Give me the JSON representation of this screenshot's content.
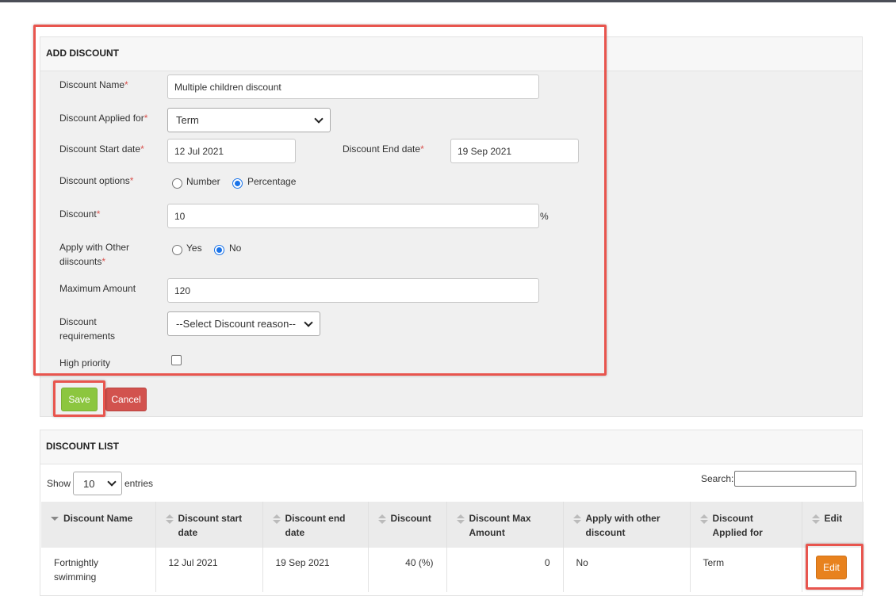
{
  "add_discount": {
    "title": "ADD DISCOUNT",
    "fields": {
      "name": {
        "label": "Discount Name",
        "required": "*",
        "value": "Multiple children discount"
      },
      "applied_for": {
        "label": "Discount Applied for",
        "required": "*",
        "value": "Term"
      },
      "start_date": {
        "label": "Discount Start date",
        "required": "*",
        "value": "12 Jul 2021"
      },
      "end_date": {
        "label": "Discount End date",
        "required": "*",
        "value": "19 Sep 2021"
      },
      "options": {
        "label": "Discount options",
        "required": "*",
        "choice_number": "Number",
        "choice_percentage": "Percentage",
        "selected": "Percentage"
      },
      "discount": {
        "label": "Discount",
        "required": "*",
        "value": "10",
        "suffix": "%"
      },
      "apply_other": {
        "label_line1": "Apply with Other",
        "label_line2": "diiscounts",
        "required": "*",
        "choice_yes": "Yes",
        "choice_no": "No",
        "selected": "No"
      },
      "max_amount": {
        "label": "Maximum Amount",
        "value": "120"
      },
      "requirements": {
        "label_line1": "Discount",
        "label_line2": "requirements",
        "value": "--Select Discount reason--"
      },
      "high_priority": {
        "label": "High priority",
        "checked": false
      }
    },
    "save_label": "Save",
    "cancel_label": "Cancel"
  },
  "discount_list": {
    "title": "DISCOUNT LIST",
    "show_label": "Show",
    "page_length": "10",
    "entries_label": "entries",
    "search_label": "Search:",
    "columns": [
      {
        "line1": "Discount Name",
        "line2": ""
      },
      {
        "line1": "Discount start",
        "line2": "date"
      },
      {
        "line1": "Discount end",
        "line2": "date"
      },
      {
        "line1": "Discount",
        "line2": ""
      },
      {
        "line1": "Discount Max",
        "line2": "Amount"
      },
      {
        "line1": "Apply with other",
        "line2": "discount"
      },
      {
        "line1": "Discount",
        "line2": "Applied for"
      },
      {
        "line1": "Edit",
        "line2": ""
      }
    ],
    "rows": [
      {
        "name_line1": "Fortnightly",
        "name_line2": "swimming",
        "start": "12 Jul 2021",
        "end": "19 Sep 2021",
        "discount": "40 (%)",
        "max_amount": "0",
        "apply_other": "No",
        "applied_for": "Term",
        "edit_label": "Edit"
      }
    ]
  },
  "colors": {
    "highlight": "#e8554e",
    "save": "#8cc63f",
    "cancel": "#d2524e",
    "edit": "#e8821e",
    "radio_selected": "#1a73e8"
  }
}
